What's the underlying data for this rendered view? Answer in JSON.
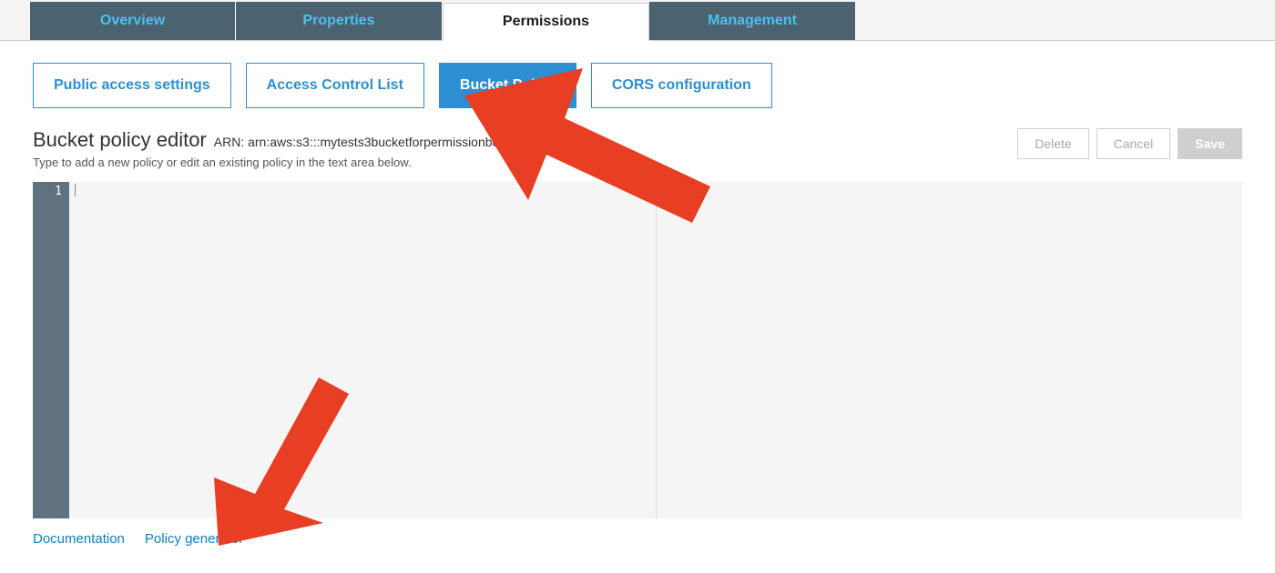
{
  "topTabs": [
    {
      "label": "Overview",
      "active": false
    },
    {
      "label": "Properties",
      "active": false
    },
    {
      "label": "Permissions",
      "active": true
    },
    {
      "label": "Management",
      "active": false
    }
  ],
  "subTabs": [
    {
      "label": "Public access settings",
      "active": false
    },
    {
      "label": "Access Control List",
      "active": false
    },
    {
      "label": "Bucket Policy",
      "active": true
    },
    {
      "label": "CORS configuration",
      "active": false
    }
  ],
  "editor": {
    "title": "Bucket policy editor",
    "arn": "ARN: arn:aws:s3:::mytests3bucketforpermissionbo",
    "hint": "Type to add a new policy or edit an existing policy in the text area below.",
    "lineNumber": "1",
    "content": ""
  },
  "actions": {
    "delete": "Delete",
    "cancel": "Cancel",
    "save": "Save"
  },
  "bottomLinks": {
    "documentation": "Documentation",
    "policyGenerator": "Policy generator"
  }
}
